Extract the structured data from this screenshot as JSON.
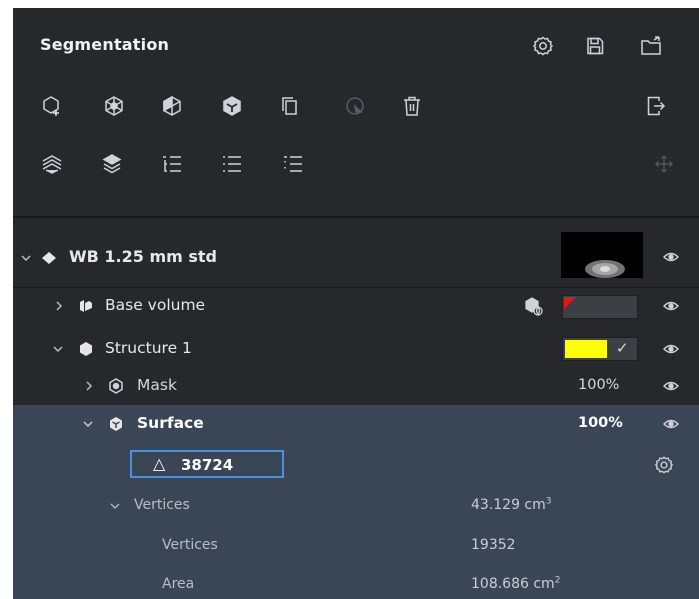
{
  "panel": {
    "title": "Segmentation"
  },
  "header_icons": [
    "settings-icon",
    "save-icon",
    "export-folder-icon"
  ],
  "toolbar_row1": [
    "add-structure-icon",
    "structure-icon",
    "structure-mask-icon",
    "structure-surface-icon",
    "copy-icon",
    "disabled-tool-icon",
    "delete-icon",
    "exit-icon"
  ],
  "toolbar_row2": [
    "layers-expand-icon",
    "layers-collapse-icon",
    "list-indent-icon",
    "list-icon",
    "list-outdent-icon",
    "move-icon"
  ],
  "tree": {
    "root": {
      "label": "WB 1.25 mm std"
    },
    "base_volume": {
      "label": "Base volume"
    },
    "structure": {
      "label": "Structure 1",
      "color": "#ffff00",
      "checkmark": "✓"
    },
    "mask": {
      "label": "Mask",
      "opacity": "100%"
    },
    "surface": {
      "label": "Surface",
      "opacity": "100%"
    },
    "triangle_count": {
      "symbol": "△",
      "value": "38724"
    }
  },
  "properties": {
    "group": {
      "label": "Vertices",
      "value": "43.129 cm",
      "unit_exp": "3"
    },
    "rows": [
      {
        "label": "Vertices",
        "value": "19352"
      },
      {
        "label": "Area",
        "value": "108.686 cm",
        "unit_exp": "2"
      }
    ]
  },
  "colors": {
    "panel_bg": "#26282c",
    "selected_row": "#3a4656",
    "accent_blue": "#4a90e2",
    "structure_color": "#ffff00",
    "red_marker": "#e0191b"
  }
}
